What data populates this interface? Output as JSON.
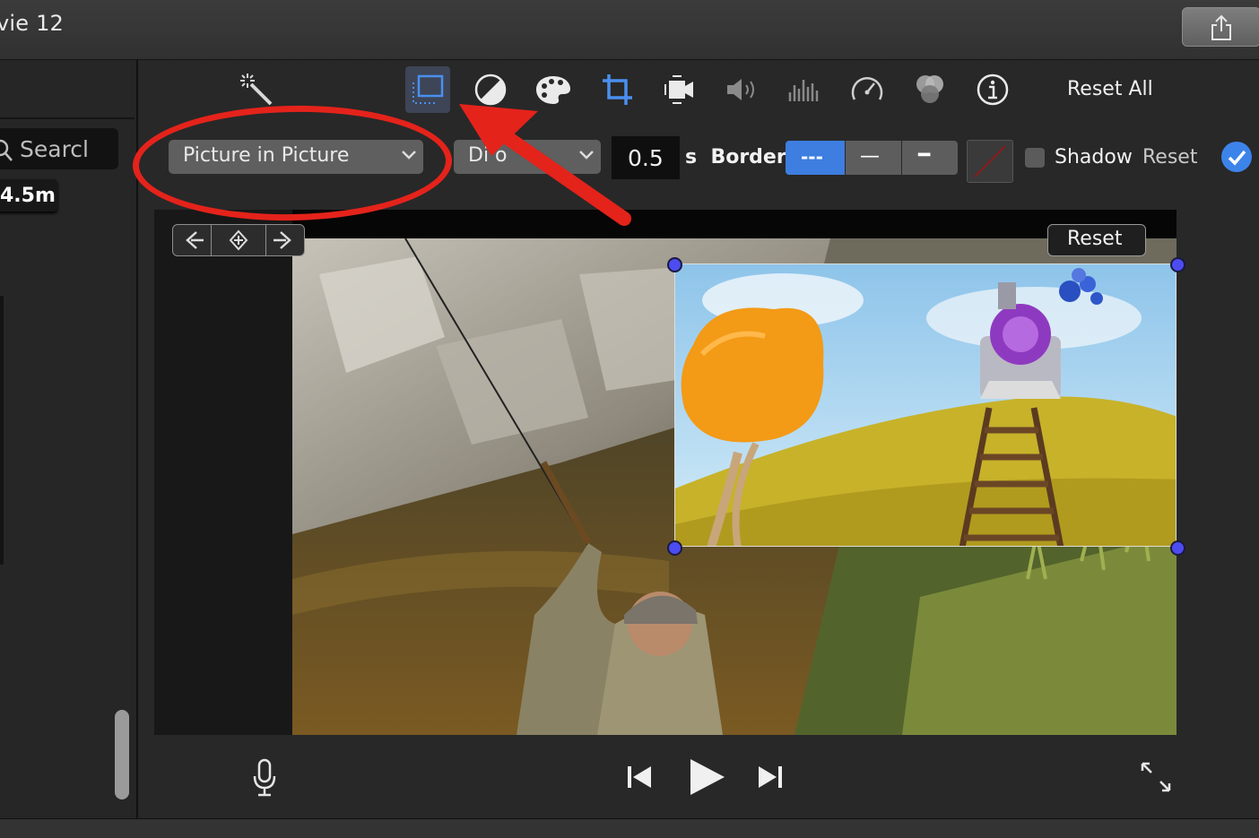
{
  "window": {
    "title": "vie 12"
  },
  "toolbar": {
    "tools": [
      {
        "name": "magic-wand"
      },
      {
        "name": "video-overlay",
        "selected": true
      },
      {
        "name": "color-balance"
      },
      {
        "name": "color-correction"
      },
      {
        "name": "crop"
      },
      {
        "name": "stabilization"
      },
      {
        "name": "volume"
      },
      {
        "name": "noise-reduction-eq"
      },
      {
        "name": "speed"
      },
      {
        "name": "clip-filter"
      },
      {
        "name": "info"
      }
    ],
    "reset_all_label": "Reset All"
  },
  "sidebar": {
    "search_placeholder": "Searcl",
    "duration_badge": "4.5m"
  },
  "overlay_settings": {
    "style_select_value": "Picture in Picture",
    "transition_select_value": "Dissolve",
    "transition_select_visible_text": "Di  o",
    "duration_value": "0.5",
    "duration_suffix": "s",
    "border_label": "Border:",
    "border_options": [
      "---",
      "—",
      "━"
    ],
    "border_selected": "---",
    "shadow_label": "Shadow",
    "shadow_checked": false,
    "reset_label": "Reset",
    "accent_color": "#3c84ea"
  },
  "viewer": {
    "pip_reset_label": "Reset",
    "keyframe_controls": [
      "previous-keyframe",
      "add-keyframe",
      "next-keyframe"
    ]
  },
  "playback": {
    "controls": [
      "microphone",
      "skip-back",
      "play",
      "skip-forward",
      "fullscreen"
    ]
  },
  "annotation": {
    "color": "#e4231b"
  }
}
